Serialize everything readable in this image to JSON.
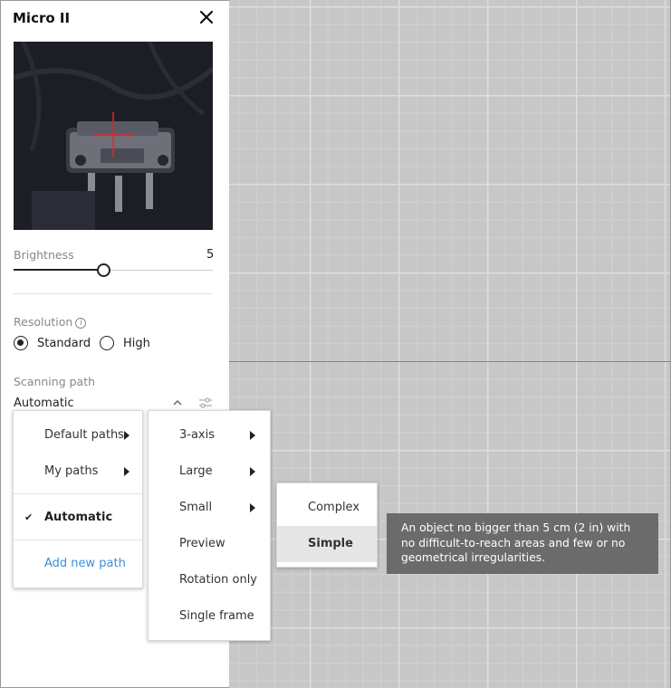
{
  "panel": {
    "title": "Micro II",
    "brightness": {
      "label": "Brightness",
      "value": "5",
      "level": 0.45
    },
    "resolution": {
      "label": "Resolution",
      "options": [
        {
          "label": "Standard",
          "selected": true
        },
        {
          "label": "High",
          "selected": false
        }
      ]
    },
    "scanning_path": {
      "label": "Scanning path",
      "value": "Automatic"
    }
  },
  "menu1": {
    "items": [
      {
        "label": "Default paths",
        "submenu": true
      },
      {
        "label": "My paths",
        "submenu": true
      }
    ],
    "automatic": {
      "label": "Automatic",
      "checked": true
    },
    "add_path": {
      "label": "Add new path",
      "color": "#3b8fd9"
    }
  },
  "menu2": {
    "items": [
      {
        "label": "3-axis",
        "submenu": true
      },
      {
        "label": "Large",
        "submenu": true
      },
      {
        "label": "Small",
        "submenu": true
      },
      {
        "label": "Preview"
      },
      {
        "label": "Rotation only"
      },
      {
        "label": "Single frame"
      }
    ]
  },
  "menu3": {
    "items": [
      {
        "label": "Complex"
      },
      {
        "label": "Simple",
        "highlighted": true
      }
    ]
  },
  "tooltip": {
    "text": "An object no bigger than 5 cm (2 in) with no difficult-to-reach areas and few or no geometrical irregularities."
  },
  "colors": {
    "accent": "#3b8fd9",
    "axis_red": "#e05050",
    "tooltip_bg": "#6b6b6b"
  }
}
